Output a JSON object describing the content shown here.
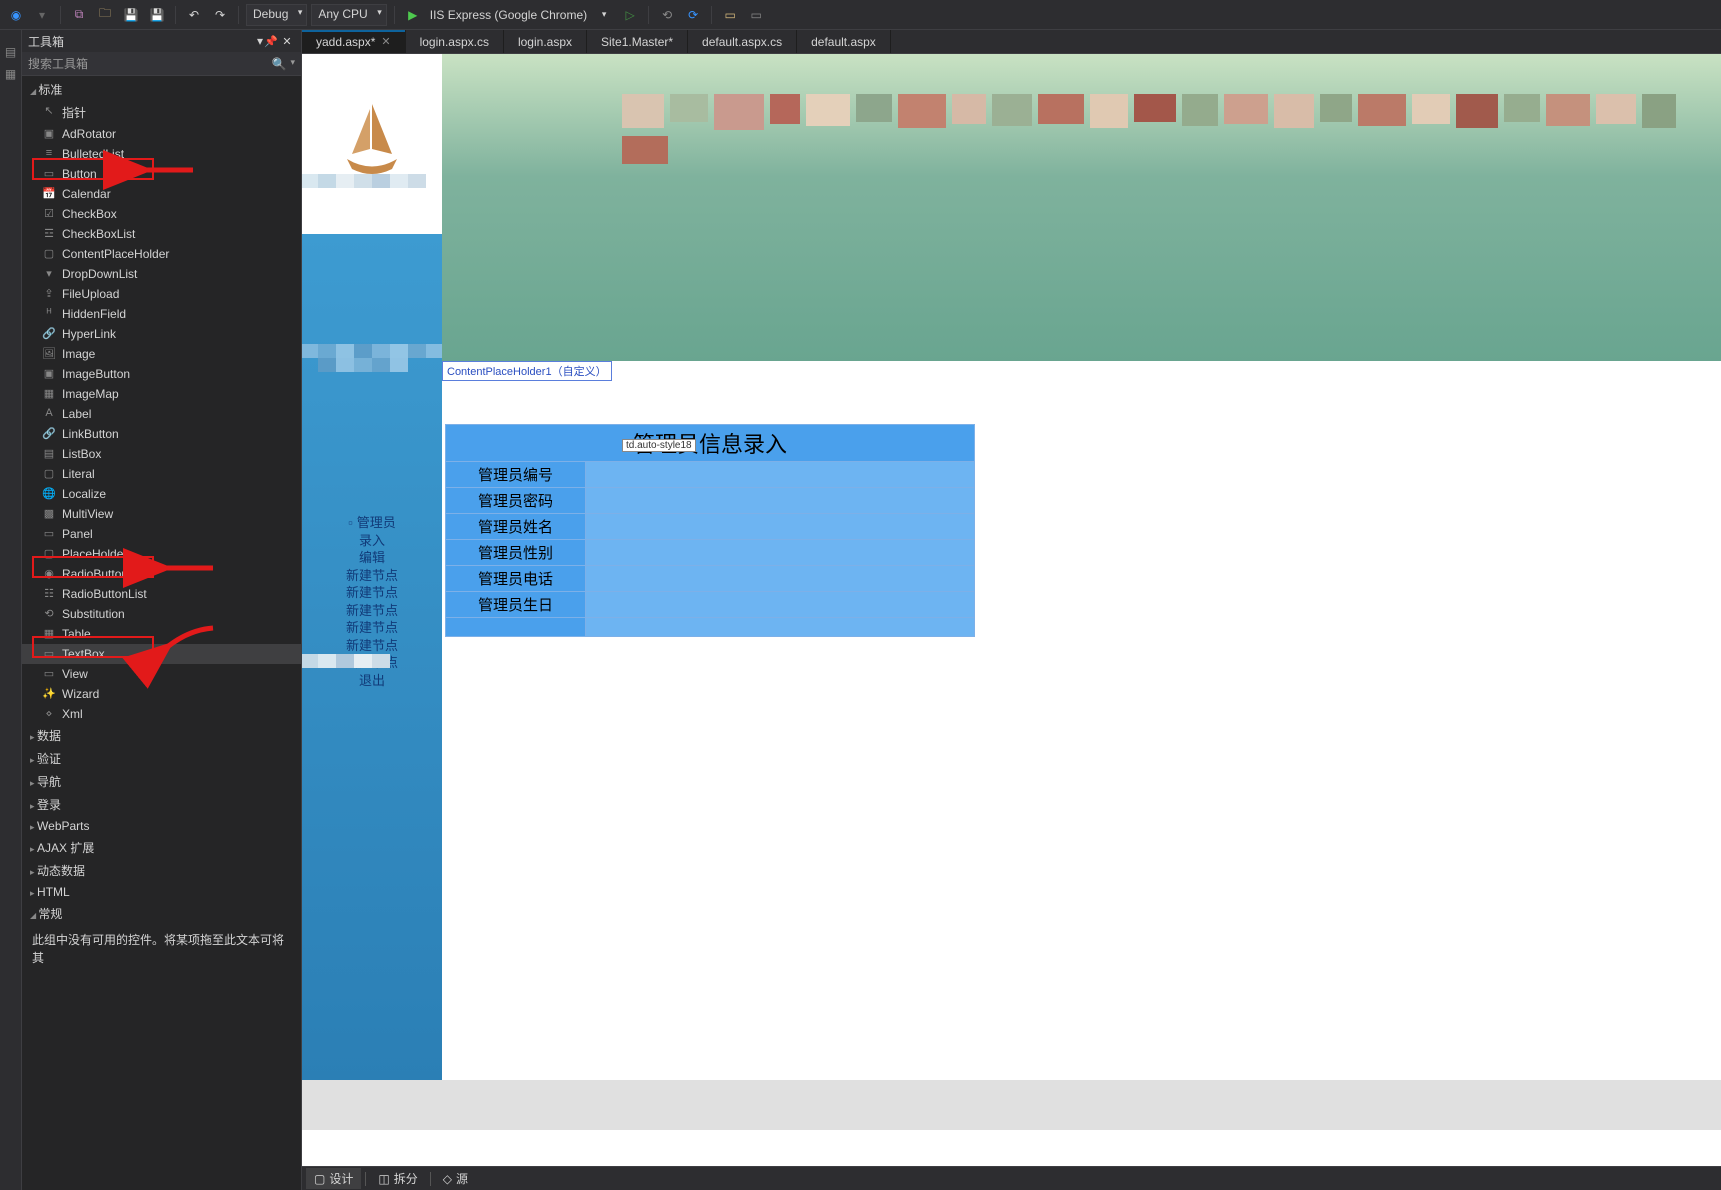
{
  "toolbar": {
    "config_label": "Debug",
    "platform_label": "Any CPU",
    "run_label": "IIS Express (Google Chrome)"
  },
  "toolbox": {
    "title": "工具箱",
    "search_placeholder": "搜索工具箱",
    "groups": {
      "standard": "标准",
      "data": "数据",
      "validation": "验证",
      "navigation": "导航",
      "login": "登录",
      "webparts": "WebParts",
      "ajax": "AJAX 扩展",
      "dynamic": "动态数据",
      "html": "HTML",
      "general": "常规"
    },
    "items": {
      "pointer": "指针",
      "adrotator": "AdRotator",
      "bulletedlist": "BulletedList",
      "button": "Button",
      "calendar": "Calendar",
      "checkbox": "CheckBox",
      "checkboxlist": "CheckBoxList",
      "contentplaceholder": "ContentPlaceHolder",
      "dropdownlist": "DropDownList",
      "fileupload": "FileUpload",
      "hiddenfield": "HiddenField",
      "hyperlink": "HyperLink",
      "image": "Image",
      "imagebutton": "ImageButton",
      "imagemap": "ImageMap",
      "label": "Label",
      "linkbutton": "LinkButton",
      "listbox": "ListBox",
      "literal": "Literal",
      "localize": "Localize",
      "multiview": "MultiView",
      "panel": "Panel",
      "placeholder": "PlaceHolder",
      "radiobutton": "RadioButton",
      "radiobuttonlist": "RadioButtonList",
      "substitution": "Substitution",
      "table": "Table",
      "textbox": "TextBox",
      "view": "View",
      "wizard": "Wizard",
      "xml": "Xml"
    },
    "empty_hint": "此组中没有可用的控件。将某项拖至此文本可将其"
  },
  "tabs": [
    {
      "label": "yadd.aspx*",
      "active": true,
      "closeable": true
    },
    {
      "label": "login.aspx.cs",
      "active": false
    },
    {
      "label": "login.aspx",
      "active": false
    },
    {
      "label": "Site1.Master*",
      "active": false
    },
    {
      "label": "default.aspx.cs",
      "active": false
    },
    {
      "label": "default.aspx",
      "active": false
    }
  ],
  "designer": {
    "cph_label": "ContentPlaceHolder1（自定义）",
    "td_badge": "td.auto-style18",
    "form_title": "管理员信息录入",
    "rows": [
      "管理员编号",
      "管理员密码",
      "管理员姓名",
      "管理员性别",
      "管理员电话",
      "管理员生日"
    ],
    "nav": {
      "line1": "管理员",
      "line2": "录入",
      "line3": "编辑",
      "new_node": "新建节点",
      "exit": "退出"
    }
  },
  "viewbar": {
    "design": "设计",
    "split": "拆分",
    "source": "源"
  }
}
